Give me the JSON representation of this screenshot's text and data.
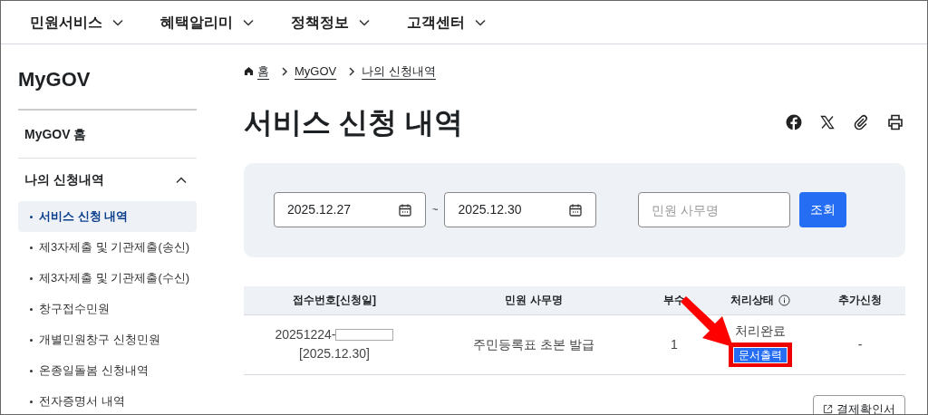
{
  "nav": [
    {
      "label": "민원서비스"
    },
    {
      "label": "혜택알리미"
    },
    {
      "label": "정책정보"
    },
    {
      "label": "고객센터"
    }
  ],
  "sidebar": {
    "title": "MyGOV",
    "home": "MyGOV 홈",
    "section": {
      "label": "나의 신청내역",
      "expanded": true
    },
    "items": [
      {
        "label": "서비스 신청 내역",
        "selected": true
      },
      {
        "label": "제3자제출 및 기관제출(송신)",
        "selected": false
      },
      {
        "label": "제3자제출 및 기관제출(수신)",
        "selected": false
      },
      {
        "label": "창구접수민원",
        "selected": false
      },
      {
        "label": "개별민원창구 신청민원",
        "selected": false
      },
      {
        "label": "온종일돌봄 신청내역",
        "selected": false
      },
      {
        "label": "전자증명서 내역",
        "selected": false
      }
    ]
  },
  "breadcrumb": [
    "홈",
    "MyGOV",
    "나의 신청내역"
  ],
  "heading": "서비스 신청 내역",
  "search": {
    "start_date": "2025.12.27",
    "separator": "~",
    "end_date": "2025.12.30",
    "placeholder": "민원 사무명",
    "button": "조회"
  },
  "table": {
    "columns": [
      "접수번호[신청일]",
      "민원 사무명",
      "부수",
      "처리상태",
      "추가신청"
    ],
    "rows": [
      {
        "number": "20251224-",
        "date": "[2025.12.30]",
        "name": "주민등록표 초본 발급",
        "copies": "1",
        "status": "처리완료",
        "action": "문서출력",
        "extra": "-"
      }
    ]
  },
  "bottom_button": "결제확인서"
}
